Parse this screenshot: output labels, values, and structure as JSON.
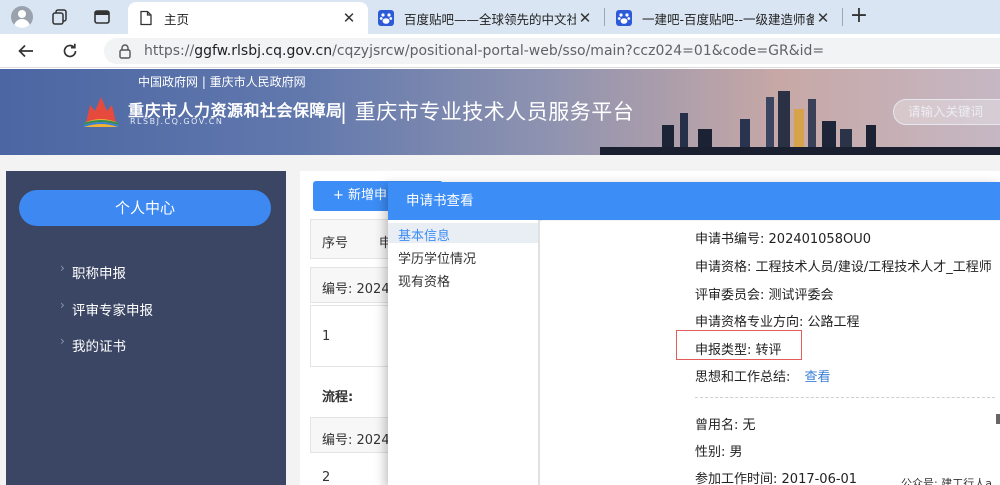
{
  "browser": {
    "tabs": [
      {
        "label": "主页",
        "active": true
      },
      {
        "label": "百度贴吧——全球领先的中文社区",
        "active": false
      },
      {
        "label": "一建吧-百度贴吧--一级建造师备考",
        "active": false
      }
    ],
    "url": "https://ggfw.rlsbj.cq.gov.cn/cqzyjsrcw/positional-portal-web/sso/main?ccz024=01&code=GR&id=",
    "url_domain": "ggfw.rlsbj.cq.gov.cn",
    "url_path": "/cqzyjsrcw/positional-portal-web/sso/main?ccz024=01&code=GR&id="
  },
  "banner": {
    "top_links": "中国政府网 | 重庆市人民政府网",
    "org_name": "重庆市人力资源和社会保障局",
    "org_sub": "RLSBJ.CQ.GOV.CN",
    "platform_name": "| 重庆市专业技术人员服务平台",
    "search_placeholder": "请输入关键词"
  },
  "sidebar": {
    "pill_label": "个人中心",
    "items": [
      {
        "label": "职称申报"
      },
      {
        "label": "评审专家申报"
      },
      {
        "label": "我的证书"
      }
    ]
  },
  "content": {
    "add_button": "+ 新增申",
    "col_no": "序号",
    "col_partial": "申",
    "row1_id": "编号: 2024",
    "row1_index": "1",
    "flow_label": "流程:",
    "row2_id": "编号: 2024",
    "row2_index": "2"
  },
  "modal": {
    "title": "申请书查看",
    "nav": [
      {
        "label": "基本信息",
        "active": true
      },
      {
        "label": "学历学位情况",
        "active": false
      },
      {
        "label": "现有资格",
        "active": false
      }
    ],
    "fields": {
      "app_no_label": "申请书编号:",
      "app_no_value": "202401058OU0",
      "qualification_label": "申请资格:",
      "qualification_value": "工程技术人员/建设/工程技术人才_工程师",
      "committee_label": "评审委员会:",
      "committee_value": "测试评委会",
      "major_label": "申请资格专业方向:",
      "major_value": "公路工程",
      "type_label": "申报类型:",
      "type_value": "转评",
      "summary_label": "思想和工作总结:",
      "summary_link": "查看",
      "former_name_label": "曾用名:",
      "former_name_value": "无",
      "gender_label": "性别:",
      "gender_value": "男",
      "work_date_label": "参加工作时间:",
      "work_date_value": "2017-06-01"
    },
    "watermark": "公众号: 建工行人a"
  },
  "colors": {
    "accent": "#3c8df5",
    "sidebar_bg": "#3a4664",
    "highlight_border": "#e35b5b",
    "link": "#3c7fd6"
  },
  "icons": {
    "profile": "avatar-icon",
    "workspaces": "workspaces-icon",
    "tab_actions": "tab-actions-icon",
    "page": "page-icon",
    "baidu": "baidu-paw-icon",
    "back": "back-arrow-icon",
    "reload": "reload-icon",
    "lock": "site-info-icon",
    "new_tab": "plus-icon"
  }
}
